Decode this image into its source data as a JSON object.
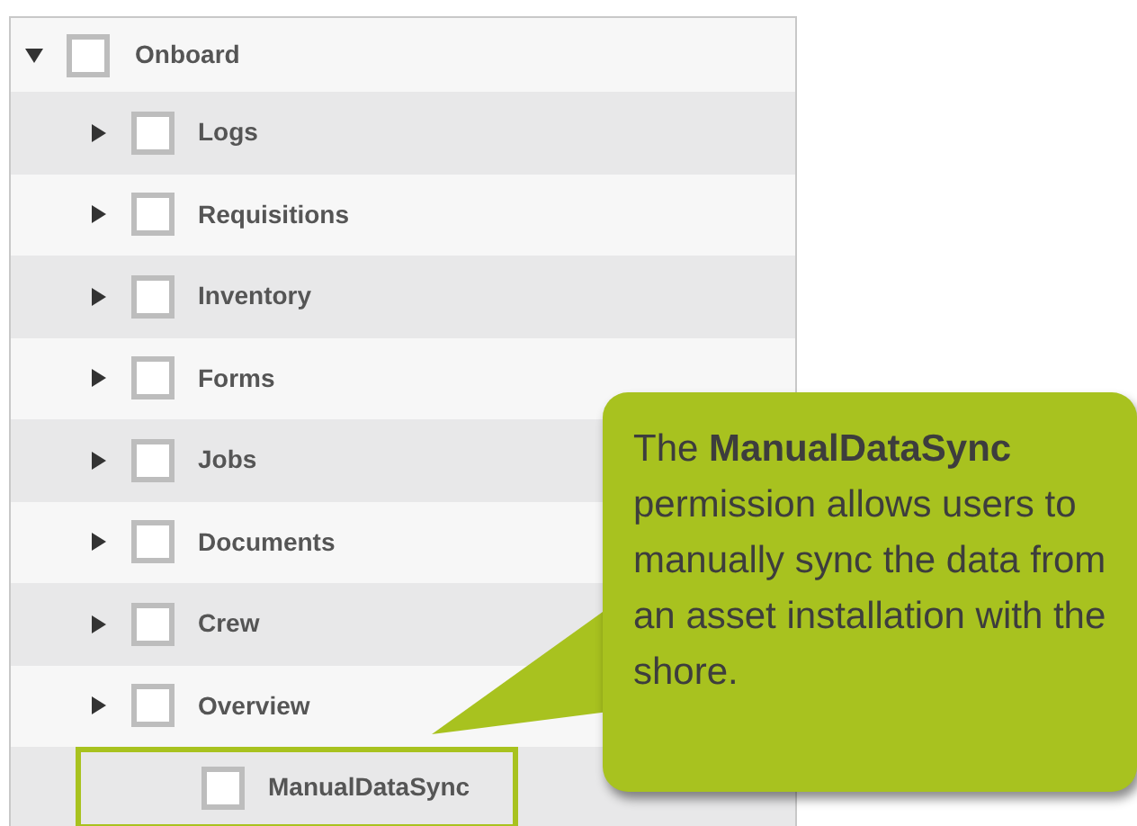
{
  "tree": {
    "label": "Onboard",
    "expanded": true,
    "checked": false,
    "children": [
      {
        "label": "Logs",
        "kind": "branch",
        "checked": false,
        "highlighted": false
      },
      {
        "label": "Requisitions",
        "kind": "branch",
        "checked": false,
        "highlighted": false
      },
      {
        "label": "Inventory",
        "kind": "branch",
        "checked": false,
        "highlighted": false
      },
      {
        "label": "Forms",
        "kind": "branch",
        "checked": false,
        "highlighted": false
      },
      {
        "label": "Jobs",
        "kind": "branch",
        "checked": false,
        "highlighted": false
      },
      {
        "label": "Documents",
        "kind": "branch",
        "checked": false,
        "highlighted": false
      },
      {
        "label": "Crew",
        "kind": "branch",
        "checked": false,
        "highlighted": false
      },
      {
        "label": "Overview",
        "kind": "branch",
        "checked": false,
        "highlighted": false
      },
      {
        "label": "ManualDataSync",
        "kind": "leaf",
        "checked": false,
        "highlighted": true
      }
    ]
  },
  "callout": {
    "text": "The **ManualDataSync** permission allows users to manually sync the data from an asset installation with the shore."
  }
}
